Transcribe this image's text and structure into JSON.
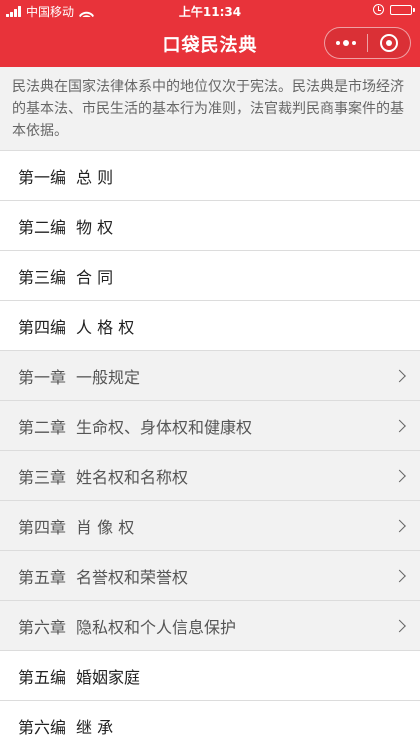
{
  "status_bar": {
    "carrier": "中国移动",
    "time": "上午11:34"
  },
  "navbar": {
    "title": "口袋民法典"
  },
  "intro": "民法典在国家法律体系中的地位仅次于宪法。民法典是市场经济的基本法、市民生活的基本行为准则，法官裁判民商事案件的基本依据。",
  "items": [
    {
      "num": "第一编",
      "title": "总 则",
      "type": "part"
    },
    {
      "num": "第二编",
      "title": "物 权",
      "type": "part"
    },
    {
      "num": "第三编",
      "title": "合 同",
      "type": "part"
    },
    {
      "num": "第四编",
      "title": "人 格 权",
      "type": "part"
    },
    {
      "num": "第一章",
      "title": "一般规定",
      "type": "chapter"
    },
    {
      "num": "第二章",
      "title": "生命权、身体权和健康权",
      "type": "chapter"
    },
    {
      "num": "第三章",
      "title": "姓名权和名称权",
      "type": "chapter"
    },
    {
      "num": "第四章",
      "title": "肖 像 权",
      "type": "chapter"
    },
    {
      "num": "第五章",
      "title": "名誉权和荣誉权",
      "type": "chapter"
    },
    {
      "num": "第六章",
      "title": "隐私权和个人信息保护",
      "type": "chapter"
    },
    {
      "num": "第五编",
      "title": "婚姻家庭",
      "type": "part"
    },
    {
      "num": "第六编",
      "title": "继 承",
      "type": "part"
    }
  ],
  "colors": {
    "brand": "#e8333a",
    "chapter_bg": "#f2f2f2"
  }
}
